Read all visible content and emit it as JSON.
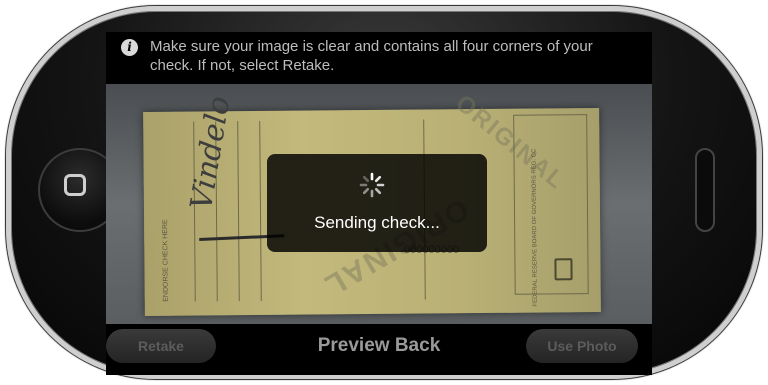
{
  "info": {
    "icon": "info-icon",
    "glyph": "i",
    "message": "Make sure your image is clear and contains all four corners of your check. If not, select Retake."
  },
  "preview": {
    "check_number": "000000000",
    "signature": "Vindelo",
    "endorse_label": "ENDORSE CHECK HERE",
    "stamp": "ORIGINAL",
    "fed_label": "FEDERAL RESERVE BOARD OF GOVERNORS REG. CC"
  },
  "hud": {
    "spinner_icon": "activity-spinner-icon",
    "status": "Sending check..."
  },
  "toolbar": {
    "retake_label": "Retake",
    "title": "Preview Back",
    "use_photo_label": "Use Photo"
  },
  "colors": {
    "screen_bg": "#000000",
    "check_paper": "#c3b97c",
    "hud_bg": "#000000",
    "toolbar_text": "#9a9a9a"
  }
}
